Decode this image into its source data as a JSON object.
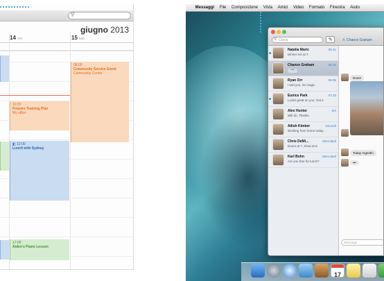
{
  "calendar": {
    "month": "giugno",
    "year": "2013",
    "days": [
      {
        "num": "14",
        "weekday": "ven"
      },
      {
        "num": "15",
        "weekday": "sab"
      }
    ],
    "events": [
      {
        "time": "08:00",
        "title": "Community Service Event",
        "location": "Community Center",
        "color": "orange"
      },
      {
        "time": "10:00",
        "title": "Prepare Training Plan",
        "location": "My office",
        "color": "orange"
      },
      {
        "time": "12:00",
        "title": "Lunch with Sydney",
        "location": "",
        "color": "blue"
      },
      {
        "time": "17:00",
        "title": "Aiden's Piano Lesson",
        "location": "",
        "color": "green"
      }
    ]
  },
  "menubar": {
    "apple": "",
    "items": [
      "Messaggi",
      "File",
      "Composizione",
      "Vista",
      "Amici",
      "Video",
      "Formato",
      "Finestra",
      "Aiuto"
    ]
  },
  "messages": {
    "search_placeholder": "Cerca",
    "to_label": "A:",
    "to_name": "Chance Graham",
    "compose_glyph": "✎",
    "conversations": [
      {
        "name": "Natalia Maric",
        "time": "05:41",
        "preview": "Dinner rez at 7.",
        "unread": true,
        "selected": false
      },
      {
        "name": "Chance Graham",
        "time": "05:40",
        "preview": "",
        "unread": false,
        "selected": true,
        "typing": "•••"
      },
      {
        "name": "Ryan Orr",
        "time": "06:05",
        "preview": "I told you, it's magic.",
        "unread": false,
        "selected": false
      },
      {
        "name": "Eunice Park",
        "time": "07:23",
        "preview": "Looks great on you. Get it.",
        "unread": true,
        "selected": false
      },
      {
        "name": "Alex Hunter",
        "time": "Ieri",
        "preview": "Will do. Thanks.",
        "unread": false,
        "selected": false
      },
      {
        "name": "Ailish Kimber",
        "time": "Giovedì",
        "preview": "Working from home today.",
        "unread": false,
        "selected": false
      },
      {
        "name": "Chris DeMi...",
        "time": "Mercoledì",
        "preview": "Doors at 7, show at 8.",
        "unread": false,
        "selected": false
      },
      {
        "name": "Karl Bohn",
        "time": "Mercoledì",
        "preview": "Are you free for lunch?",
        "unread": false,
        "selected": false
      }
    ],
    "chat": {
      "bubble1": "Done!",
      "bubble2": "Today Argentin",
      "typing": "•••",
      "input_placeholder": "iMessage"
    }
  },
  "dock": {
    "calendar_day": "17"
  }
}
